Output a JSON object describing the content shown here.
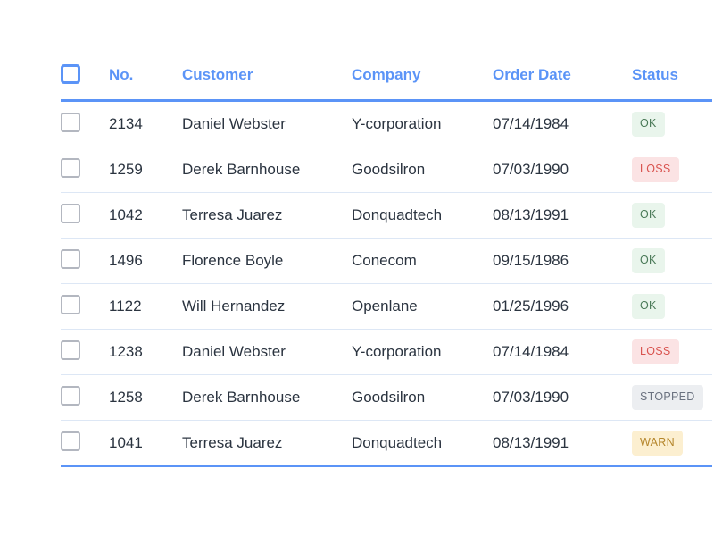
{
  "table": {
    "header": {
      "select_all_icon": "checkbox-unchecked-icon",
      "columns": [
        {
          "key": "no",
          "label": "No."
        },
        {
          "key": "customer",
          "label": "Customer"
        },
        {
          "key": "company",
          "label": "Company"
        },
        {
          "key": "date",
          "label": "Order Date"
        },
        {
          "key": "status",
          "label": "Status"
        }
      ]
    },
    "rows": [
      {
        "no": "2134",
        "customer": "Daniel Webster",
        "company": "Y-corporation",
        "date": "07/14/1984",
        "status": "OK",
        "status_kind": "ok"
      },
      {
        "no": "1259",
        "customer": "Derek Barnhouse",
        "company": "Goodsilron",
        "date": "07/03/1990",
        "status": "LOSS",
        "status_kind": "loss"
      },
      {
        "no": "1042",
        "customer": "Terresa Juarez",
        "company": "Donquadtech",
        "date": "08/13/1991",
        "status": "OK",
        "status_kind": "ok"
      },
      {
        "no": "1496",
        "customer": "Florence Boyle",
        "company": "Conecom",
        "date": "09/15/1986",
        "status": "OK",
        "status_kind": "ok"
      },
      {
        "no": "1122",
        "customer": "Will Hernandez",
        "company": "Openlane",
        "date": "01/25/1996",
        "status": "OK",
        "status_kind": "ok"
      },
      {
        "no": "1238",
        "customer": "Daniel Webster",
        "company": "Y-corporation",
        "date": "07/14/1984",
        "status": "LOSS",
        "status_kind": "loss"
      },
      {
        "no": "1258",
        "customer": "Derek Barnhouse",
        "company": "Goodsilron",
        "date": "07/03/1990",
        "status": "STOPPED",
        "status_kind": "stopped"
      },
      {
        "no": "1041",
        "customer": "Terresa Juarez",
        "company": "Donquadtech",
        "date": "08/13/1991",
        "status": "WARN",
        "status_kind": "warn"
      }
    ],
    "row_checkbox_icon": "checkbox-unchecked-icon"
  },
  "colors": {
    "accent": "#5b94f7",
    "text": "#2b3440",
    "row_divider": "#dde7f5",
    "checkbox_border": "#b3b7c0",
    "status_ok_bg": "#e9f5ec",
    "status_ok_fg": "#4a7a58",
    "status_loss_bg": "#fbe3e4",
    "status_loss_fg": "#d9534f",
    "status_stopped_bg": "#eceef1",
    "status_stopped_fg": "#6b7280",
    "status_warn_bg": "#fcefd0",
    "status_warn_fg": "#b5862b"
  }
}
